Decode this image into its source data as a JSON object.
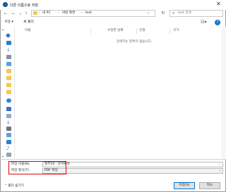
{
  "window": {
    "title": "다른 이름으로 저장",
    "close_glyph": "✕"
  },
  "address_bar": {
    "crumbs": [
      "내 PC",
      "바탕 화면",
      "test"
    ],
    "separator": "›",
    "dropdown_glyph": "⌄",
    "refresh_glyph": "↻",
    "search_placeholder": "test 검색",
    "back_glyph": "←",
    "forward_glyph": "→",
    "up_glyph": "↑"
  },
  "toolbar": {
    "organize_label": "구성 ▾",
    "new_folder_label": "새 폴더",
    "help_label": "?"
  },
  "file_list": {
    "columns": [
      "이름",
      "수정한 날짜",
      "유형",
      "크기"
    ],
    "empty_message": "검색하는 항목이 없습니다."
  },
  "form": {
    "filename_label": "파일 이름(N):",
    "filename_value": "정부24 - 문서출력",
    "filetype_label": "파일 형식(T):",
    "filetype_value": "PDF 파일",
    "dropdown_glyph": "⌄"
  },
  "footer": {
    "hide_folders_label": "⌃ 폴더 숨기기",
    "save_label": "저장(S)",
    "cancel_label": "취소"
  },
  "colors": {
    "highlight_box": "#e00000",
    "folder": "#f3c94f",
    "accent": "#0078d7"
  }
}
